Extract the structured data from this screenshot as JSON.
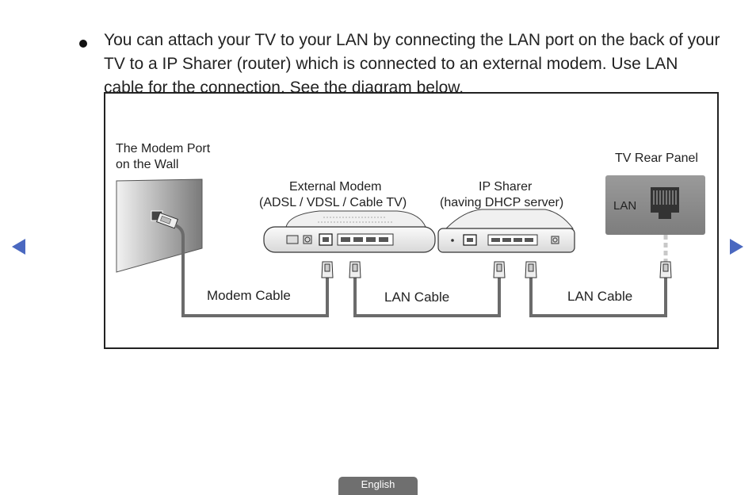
{
  "instructions": {
    "bullet_text": "You can attach your TV to your LAN by connecting the LAN port on the back of your TV to a IP Sharer (router) which is connected to an external modem. Use LAN cable for the connection. See the diagram below."
  },
  "diagram": {
    "wall_label_line1": "The Modem Port",
    "wall_label_line2": "on the Wall",
    "modem_label_line1": "External Modem",
    "modem_label_line2": "(ADSL / VDSL / Cable TV)",
    "sharer_label_line1": "IP Sharer",
    "sharer_label_line2": "(having DHCP server)",
    "tv_label": "TV Rear Panel",
    "tv_port_label": "LAN",
    "cable1_label": "Modem Cable",
    "cable2_label": "LAN Cable",
    "cable3_label": "LAN Cable"
  },
  "navigation": {
    "prev_icon": "triangle-left",
    "next_icon": "triangle-right",
    "arrow_color": "#4a68c0"
  },
  "footer": {
    "language_label": "English"
  }
}
